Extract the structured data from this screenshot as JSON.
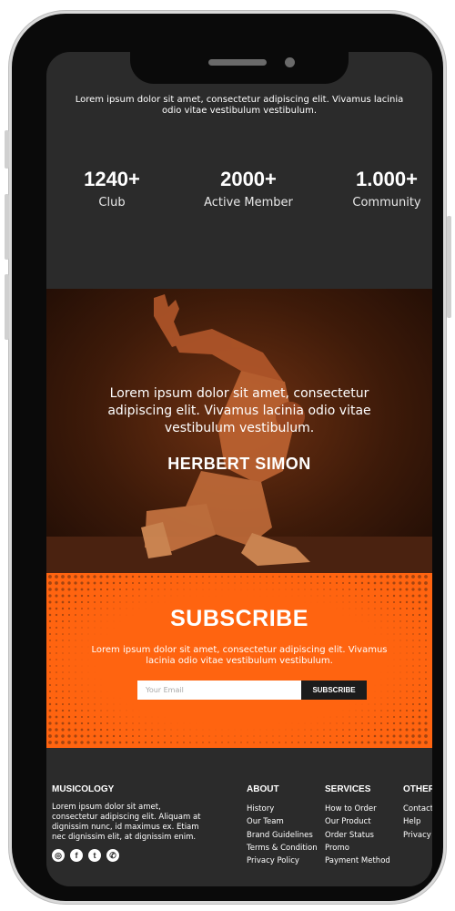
{
  "intro": {
    "text": "Lorem ipsum dolor sit amet, consectetur adipiscing elit. Vivamus lacinia odio vitae vestibulum vestibulum."
  },
  "stats": [
    {
      "value": "1240+",
      "label": "Club"
    },
    {
      "value": "2000+",
      "label": "Active Member"
    },
    {
      "value": "1.000+",
      "label": "Community"
    }
  ],
  "hero": {
    "quote": "Lorem ipsum dolor sit amet, consectetur adipiscing elit. Vivamus lacinia odio vitae vestibulum vestibulum.",
    "name": "HERBERT SIMON"
  },
  "subscribe": {
    "title": "SUBSCRIBE",
    "text": "Lorem ipsum dolor sit amet, consectetur adipiscing elit. Vivamus lacinia odio vitae vestibulum vestibulum.",
    "placeholder": "Your Email",
    "button": "SUBSCRIBE"
  },
  "footer": {
    "brand": "MUSICOLOGY",
    "description": "Lorem ipsum dolor sit amet, consectetur adipiscing elit. Aliquam at dignissim nunc, id maximus ex. Etiam nec dignissim elit, at dignissim enim.",
    "social_icons": [
      "instagram-icon",
      "facebook-icon",
      "twitter-icon",
      "whatsapp-icon"
    ],
    "columns": [
      {
        "heading": "ABOUT",
        "links": [
          "History",
          "Our Team",
          "Brand Guidelines",
          "Terms & Condition",
          "Privacy Policy"
        ]
      },
      {
        "heading": "SERVICES",
        "links": [
          "How to Order",
          "Our Product",
          "Order Status",
          "Promo",
          "Payment Method"
        ]
      },
      {
        "heading": "OTHERS",
        "links": [
          "Contact Us",
          "Help",
          "Privacy"
        ]
      }
    ]
  },
  "colors": {
    "background": "#2b2b2b",
    "accent": "#ff6410",
    "hero_tint": "#6e3112",
    "button": "#1c1c1c",
    "text": "#ffffff"
  }
}
